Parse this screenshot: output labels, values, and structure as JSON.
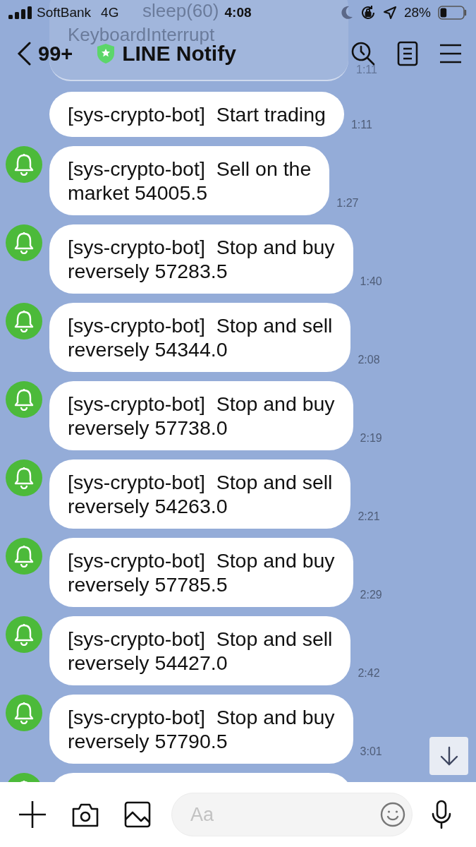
{
  "status_bar": {
    "carrier": "SoftBank",
    "network": "4G",
    "time": "4:08",
    "battery": "28%"
  },
  "header": {
    "back_count": "99+",
    "title": "LINE Notify"
  },
  "hidden_message": {
    "lines": [
      "sleep(60)",
      "KeyboardInterrupt"
    ],
    "time": "1:11"
  },
  "messages": [
    {
      "kind": "text",
      "avatar": false,
      "text": "[sys-crypto-bot]  Start trading",
      "time": "1:11"
    },
    {
      "kind": "text",
      "avatar": true,
      "text": "[sys-crypto-bot]  Sell on the\nmarket 54005.5",
      "time": "1:27"
    },
    {
      "kind": "text",
      "avatar": true,
      "text": "[sys-crypto-bot]  Stop and buy\nreversely 57283.5",
      "time": "1:40"
    },
    {
      "kind": "text",
      "avatar": true,
      "text": "[sys-crypto-bot]  Stop and sell\nreversely 54344.0",
      "time": "2:08"
    },
    {
      "kind": "text",
      "avatar": true,
      "text": "[sys-crypto-bot]  Stop and buy\nreversely 57738.0",
      "time": "2:19"
    },
    {
      "kind": "text",
      "avatar": true,
      "text": "[sys-crypto-bot]  Stop and sell\nreversely 54263.0",
      "time": "2:21"
    },
    {
      "kind": "text",
      "avatar": true,
      "text": "[sys-crypto-bot]  Stop and buy\nreversely 57785.5",
      "time": "2:29"
    },
    {
      "kind": "text",
      "avatar": true,
      "text": "[sys-crypto-bot]  Stop and sell\nreversely 54427.0",
      "time": "2:42"
    },
    {
      "kind": "text",
      "avatar": true,
      "text": "[sys-crypto-bot]  Stop and buy\nreversely 57790.5",
      "time": "3:01"
    },
    {
      "kind": "cut",
      "avatar": true
    }
  ],
  "composer": {
    "placeholder": "Aa"
  }
}
